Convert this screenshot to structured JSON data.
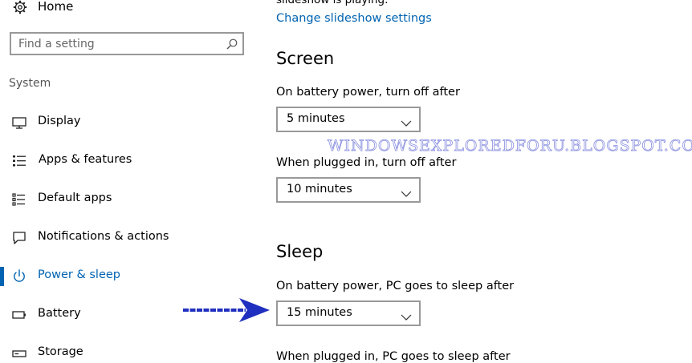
{
  "sidebar": {
    "home_label": "Home",
    "search_placeholder": "Find a setting",
    "section_label": "System",
    "items": [
      {
        "label": "Display",
        "icon": "monitor-icon"
      },
      {
        "label": "Apps & features",
        "icon": "list-icon"
      },
      {
        "label": "Default apps",
        "icon": "default-apps-icon"
      },
      {
        "label": "Notifications & actions",
        "icon": "message-icon"
      },
      {
        "label": "Power & sleep",
        "icon": "power-icon",
        "active": true
      },
      {
        "label": "Battery",
        "icon": "battery-icon"
      },
      {
        "label": "Storage",
        "icon": "storage-icon"
      }
    ]
  },
  "main": {
    "truncated_text": "slideshow is playing.",
    "link_label": "Change slideshow settings",
    "screen": {
      "heading": "Screen",
      "battery_label": "On battery power, turn off after",
      "battery_value": "5 minutes",
      "plugged_label": "When plugged in, turn off after",
      "plugged_value": "10 minutes"
    },
    "sleep": {
      "heading": "Sleep",
      "battery_label": "On battery power, PC goes to sleep after",
      "battery_value": "15 minutes",
      "plugged_label": "When plugged in, PC goes to sleep after"
    }
  },
  "watermark": "WINDOWSEXPLOREDFORU.BLOGSPOT.COM",
  "colors": {
    "accent": "#0063b1",
    "arrow": "#1f2fbf",
    "watermark_outline": "#8a90e0"
  }
}
